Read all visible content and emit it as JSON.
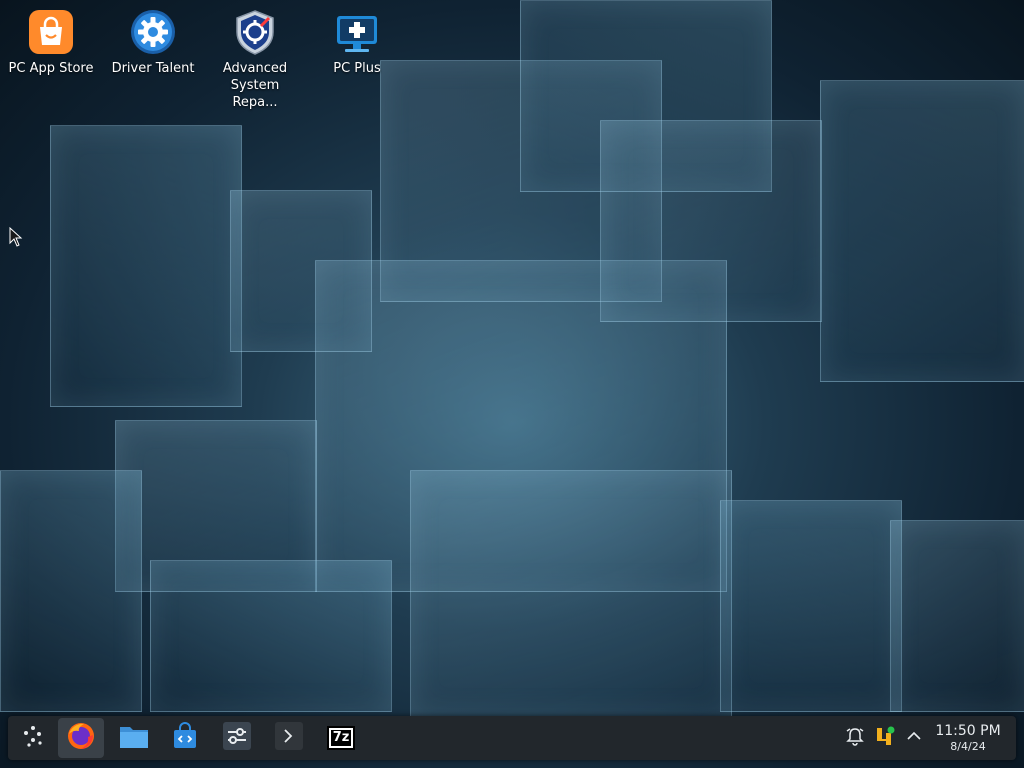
{
  "desktop": {
    "icons": [
      {
        "label": "PC App Store",
        "icon": "shopping-bag-icon"
      },
      {
        "label": "Driver Talent",
        "icon": "gear-icon"
      },
      {
        "label": "Advanced System Repa...",
        "icon": "shield-gear-icon"
      },
      {
        "label": "PC Plus",
        "icon": "monitor-plus-icon"
      }
    ]
  },
  "taskbar": {
    "buttons": [
      {
        "icon": "application-launcher-icon"
      },
      {
        "icon": "firefox-icon",
        "active": true
      },
      {
        "icon": "file-manager-icon"
      },
      {
        "icon": "discover-store-icon"
      },
      {
        "icon": "system-settings-icon"
      },
      {
        "icon": "terminal-icon"
      },
      {
        "icon": "7zip-icon",
        "text": "7z"
      }
    ],
    "tray": [
      {
        "icon": "notifications-icon"
      },
      {
        "icon": "update-notifier-icon"
      },
      {
        "icon": "show-hidden-icons-icon"
      }
    ],
    "clock": {
      "time": "11:50 PM",
      "date": "8/4/24"
    }
  },
  "colors": {
    "taskbar_bg": "#22272c",
    "accent_orange": "#ff8a2b",
    "accent_blue": "#2e8be0"
  }
}
